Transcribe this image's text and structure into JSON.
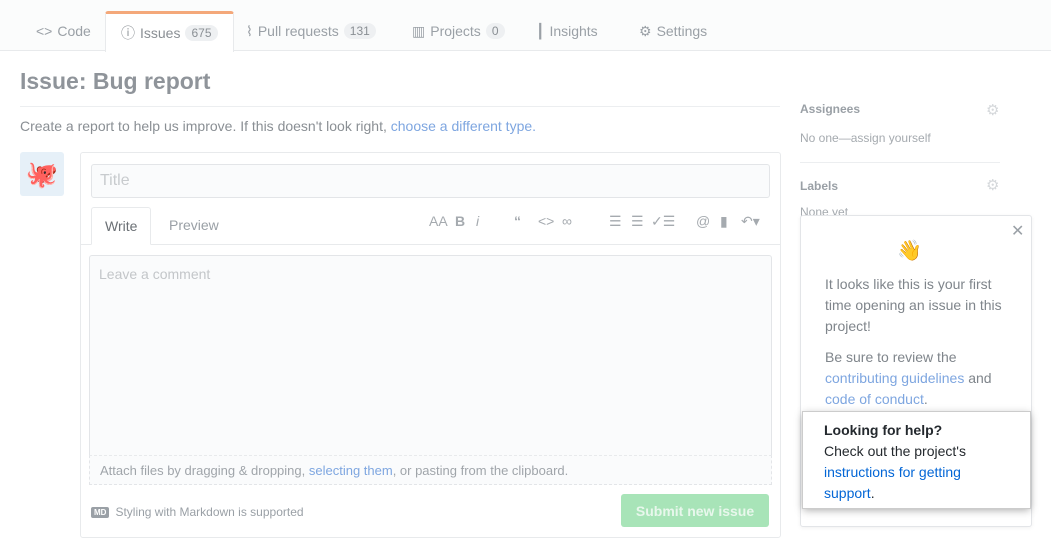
{
  "tabs": [
    {
      "label": "Code",
      "icon": "code-icon"
    },
    {
      "label": "Issues",
      "count": "675",
      "icon": "issue-opened-icon",
      "selected": true
    },
    {
      "label": "Pull requests",
      "count": "131",
      "icon": "git-pull-request-icon"
    },
    {
      "label": "Projects",
      "count": "0",
      "icon": "project-icon"
    },
    {
      "label": "Insights",
      "icon": "graph-icon"
    },
    {
      "label": "Settings",
      "icon": "gear-icon"
    }
  ],
  "page": {
    "title": "Issue: Bug report",
    "intro": "Create a report to help us improve. If this doesn't look right, ",
    "intro_link": "choose a different type."
  },
  "form": {
    "title_placeholder": "Title",
    "write_tab": "Write",
    "preview_tab": "Preview",
    "comment_placeholder": "Leave a comment",
    "attach_pre": "Attach files by dragging & dropping, ",
    "attach_link": "selecting them",
    "attach_post": ", or pasting from the clipboard.",
    "markdown_note": "Styling with Markdown is supported",
    "markdown_badge": "MD",
    "submit": "Submit new issue"
  },
  "sidebar": {
    "assignees_label": "Assignees",
    "assignees_value": "No one—assign yourself",
    "labels_label": "Labels",
    "labels_value": "None yet"
  },
  "popover": {
    "emoji": "👋",
    "line1": "It looks like this is your first time opening an issue in this project!",
    "line2_pre": "Be sure to review the ",
    "line2_link1": "contributing guidelines",
    "line2_mid": " and ",
    "line2_link2": "code of conduct",
    "line2_post": ".",
    "help_title": "Looking for help?",
    "help_pre": "Check out the project's ",
    "help_link": "instructions for getting support",
    "help_post": "."
  }
}
